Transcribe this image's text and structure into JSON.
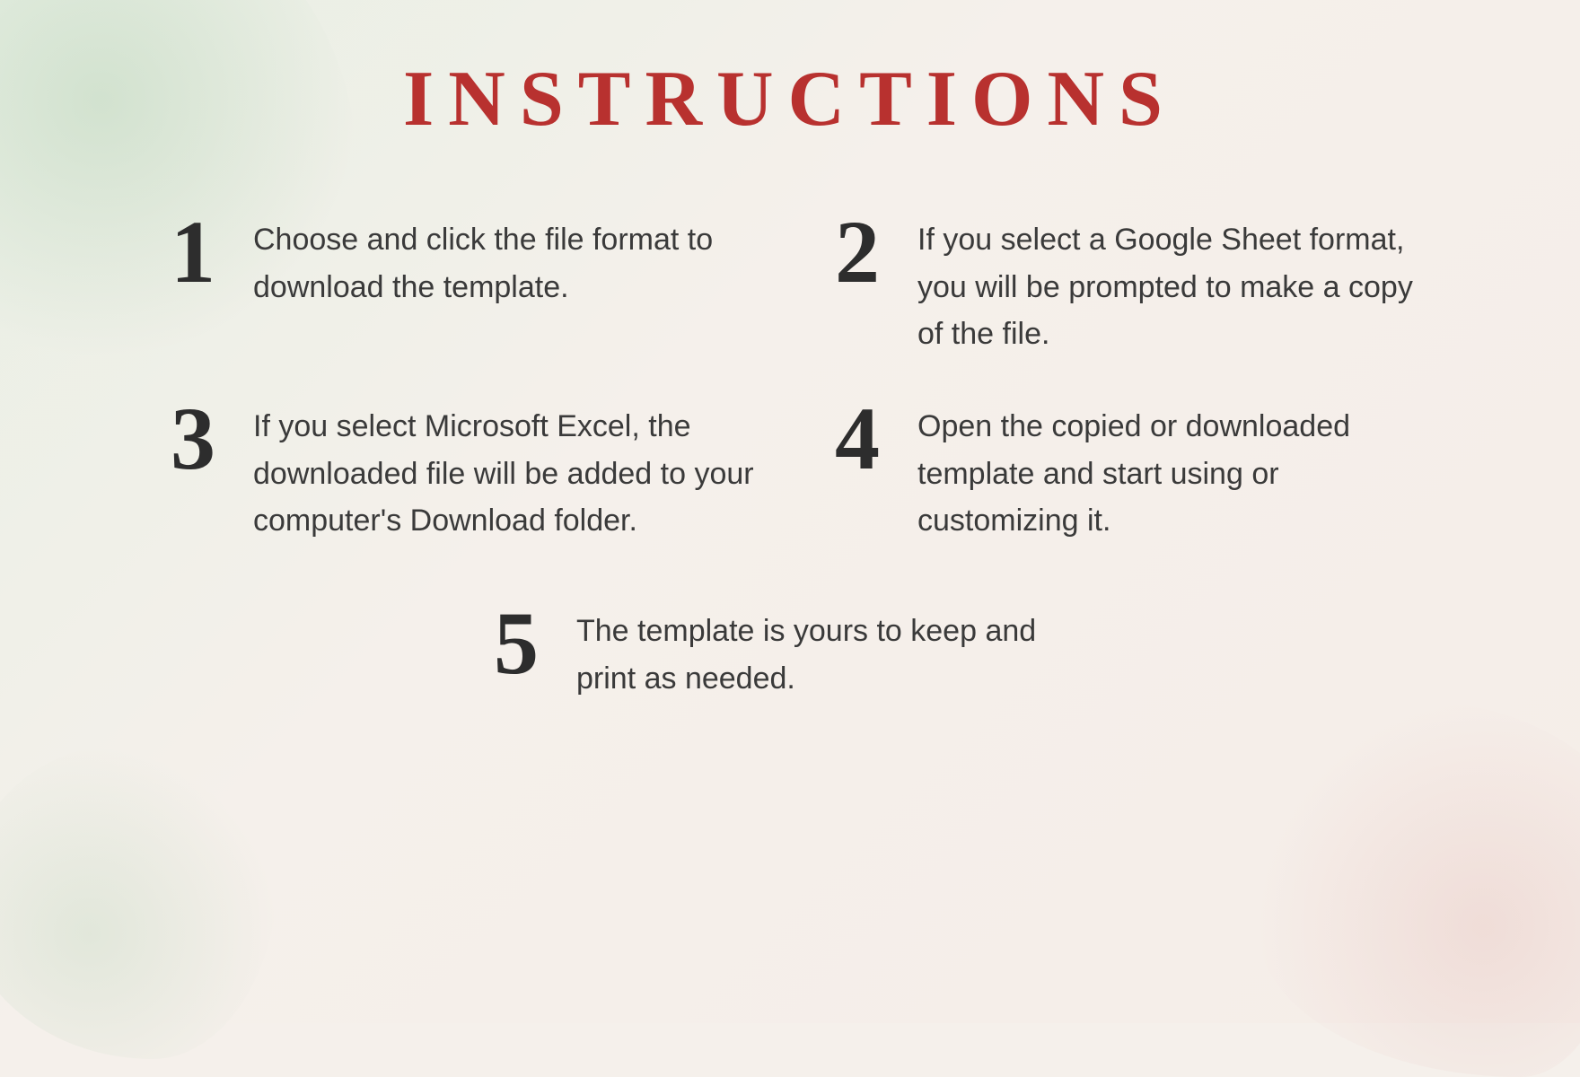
{
  "page": {
    "title": "INSTRUCTIONS",
    "title_color": "#b8312f"
  },
  "steps": [
    {
      "id": "step-1",
      "number": "1",
      "text": "Choose and click the file format to download the template."
    },
    {
      "id": "step-2",
      "number": "2",
      "text": "If you select a Google Sheet format, you will be prompted to make a copy of the file."
    },
    {
      "id": "step-3",
      "number": "3",
      "text": "If you select Microsoft Excel, the downloaded file will be added to your computer's Download  folder."
    },
    {
      "id": "step-4",
      "number": "4",
      "text": "Open the copied or downloaded template and start using or customizing it."
    },
    {
      "id": "step-5",
      "number": "5",
      "text": "The template is yours to keep and print as needed."
    }
  ]
}
